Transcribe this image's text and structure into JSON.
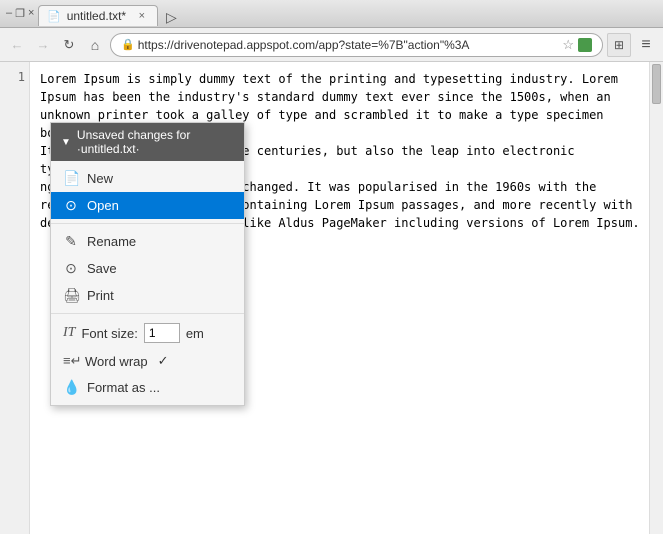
{
  "titlebar": {
    "tab_label": "untitled.txt*",
    "tab_icon": "📄",
    "close_label": "×",
    "new_tab_label": "▷",
    "win_minimize": "–",
    "win_restore": "❐",
    "win_close": "×"
  },
  "addressbar": {
    "back_icon": "←",
    "forward_icon": "→",
    "reload_icon": "↻",
    "home_icon": "⌂",
    "url_secure_label": "🔒",
    "url_text": "https://drivenotepad.appspot.com/app?state=%7B\"action\"%3A",
    "star_icon": "☆",
    "puzzle_icon": "✦",
    "more_icon": "≡",
    "extensions_icon": "⊞"
  },
  "editor": {
    "line_number": "1",
    "content": "Lorem Ipsum is simply dummy text of the printing and typesetting industry. Lorem\nIpsum has been the industry's standard dummy text ever since the 1500s, when an\nunknown printer took a galley of type and scrambled it to make a type specimen book.\nIt has survived not only five centuries, but also the leap into electronic typesetti\nng, remaining essentially unchanged. It was popularised in the 1960s with the\nrelease of Letraset sheets containing Lorem Ipsum passages, and more recently with\ndesktop publishing software like Aldus PageMaker including versions of Lorem Ipsum."
  },
  "dropdown": {
    "header_text": "Unsaved changes for ·untitled.txt·",
    "header_arrow": "▼",
    "items": [
      {
        "id": "new",
        "icon": "📄",
        "label": "New"
      },
      {
        "id": "open",
        "icon": "⊙",
        "label": "Open",
        "active": true
      },
      {
        "id": "rename",
        "icon": "✎",
        "label": "Rename"
      },
      {
        "id": "save",
        "icon": "⊙",
        "label": "Save"
      },
      {
        "id": "print",
        "icon": "🖨",
        "label": "Print"
      }
    ],
    "font_size_label": "Font size:",
    "font_size_icon": "IT",
    "font_size_value": "1",
    "font_size_unit": "em",
    "word_wrap_label": "Word wrap",
    "word_wrap_check": "✓",
    "format_label": "Format as ..."
  }
}
